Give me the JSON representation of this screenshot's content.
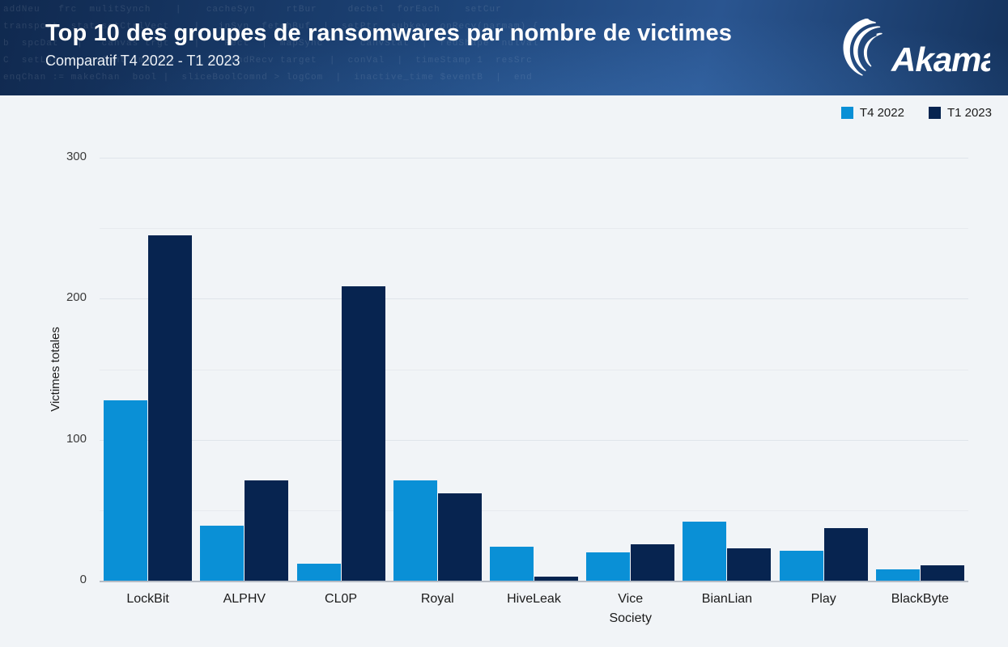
{
  "header": {
    "title": "Top 10 des groupes de ransomwares par nombre de victimes",
    "subtitle": "Comparatif T4 2022 - T1 2023",
    "logo_name": "Akamai",
    "background_code": "addNeu   frc  mulitSynch    |    cacheSyn     rtBur     decbel  forEach    setCur\ntransport  stat setCtrlVect    |   inSyn  fetchBuf  |  setPtr  subkey  onRecv(parmam) {\nb  spcDat   |   canvas trgt    |    Rect  |  mapSync      canvStat  |  redShape  nulVal\nC  setLst  |  exCont  mulVec   |  appendRecv target  |  conVal  |  timeStamp 1  resSrc\nenqChan := makeChan  bool |  sliceBoolComnd > logCom  |  inactive_time $eventB  |  end"
  },
  "legend": {
    "position": "top-right",
    "items": [
      {
        "label": "T4 2022",
        "color": "#0a90d6",
        "icon": "legend-swatch"
      },
      {
        "label": "T1 2023",
        "color": "#072450",
        "icon": "legend-swatch"
      }
    ]
  },
  "chart_data": {
    "type": "bar",
    "title": "Top 10 des groupes de ransomwares par nombre de victimes",
    "subtitle": "Comparatif T4 2022 - T1 2023",
    "xlabel": "",
    "ylabel": "Victimes totales",
    "ylim": [
      0,
      300
    ],
    "yticks": [
      0,
      100,
      200,
      300
    ],
    "ytick_labels": [
      "0",
      "100",
      "200",
      "300"
    ],
    "minor_gridlines": [
      50,
      150,
      250
    ],
    "grid": true,
    "legend_position": "top-right",
    "categories": [
      "LockBit",
      "ALPHV",
      "CL0P",
      "Royal",
      "HiveLeak",
      "Vice\nSociety",
      "BianLian",
      "Play",
      "BlackByte"
    ],
    "series": [
      {
        "name": "T4 2022",
        "color": "#0a90d6",
        "values": [
          128,
          39,
          12,
          71,
          24,
          20,
          42,
          21,
          8
        ]
      },
      {
        "name": "T1 2023",
        "color": "#072450",
        "values": [
          245,
          71,
          209,
          62,
          3,
          26,
          23,
          37,
          11
        ]
      }
    ]
  },
  "colors": {
    "brand_navy": "#072450",
    "brand_blue": "#0a90d6",
    "panel_bg": "#f1f4f7",
    "gridline": "#dfe4ea",
    "axis": "#b6bcc4"
  }
}
